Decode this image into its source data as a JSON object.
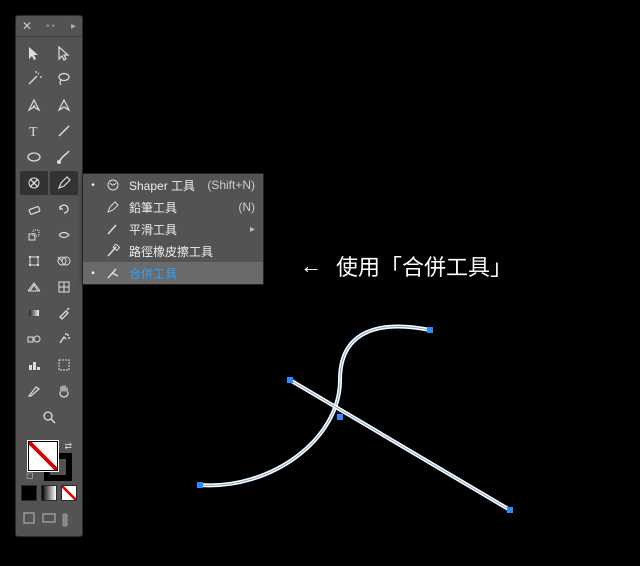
{
  "tools": [
    {
      "name": "selection-tool",
      "svg": "sel"
    },
    {
      "name": "direct-selection-tool",
      "svg": "dsel"
    },
    {
      "name": "magic-wand-tool",
      "svg": "wand"
    },
    {
      "name": "lasso-tool",
      "svg": "lasso"
    },
    {
      "name": "pen-tool",
      "svg": "pen"
    },
    {
      "name": "curvature-tool",
      "svg": "curv"
    },
    {
      "name": "type-tool",
      "svg": "type"
    },
    {
      "name": "line-segment-tool",
      "svg": "line"
    },
    {
      "name": "ellipse-tool",
      "svg": "ellipse"
    },
    {
      "name": "paintbrush-tool",
      "svg": "brush"
    },
    {
      "name": "shaper-tool",
      "svg": "shaper",
      "selected": true
    },
    {
      "name": "pencil-tool",
      "svg": "pencil",
      "open": true
    },
    {
      "name": "eraser-tool",
      "svg": "eraser"
    },
    {
      "name": "rotate-tool",
      "svg": "rotate"
    },
    {
      "name": "scale-tool",
      "svg": "scale"
    },
    {
      "name": "width-tool",
      "svg": "width"
    },
    {
      "name": "free-transform-tool",
      "svg": "freetr"
    },
    {
      "name": "shape-builder-tool",
      "svg": "shapeb"
    },
    {
      "name": "perspective-grid-tool",
      "svg": "persp"
    },
    {
      "name": "mesh-tool",
      "svg": "mesh"
    },
    {
      "name": "gradient-tool",
      "svg": "grad"
    },
    {
      "name": "eyedropper-tool",
      "svg": "eye"
    },
    {
      "name": "blend-tool",
      "svg": "blend"
    },
    {
      "name": "symbol-sprayer-tool",
      "svg": "spray"
    },
    {
      "name": "column-graph-tool",
      "svg": "graph"
    },
    {
      "name": "artboard-tool",
      "svg": "artb"
    },
    {
      "name": "slice-tool",
      "svg": "slice"
    },
    {
      "name": "hand-tool",
      "svg": "hand"
    },
    {
      "name": "zoom-tool",
      "svg": "zoom"
    }
  ],
  "flyout": {
    "items": [
      {
        "checked": true,
        "label": "Shaper 工具",
        "shortcut": "(Shift+N)",
        "icon": "shaper"
      },
      {
        "label": "鉛筆工具",
        "shortcut": "(N)",
        "icon": "pencil"
      },
      {
        "label": "平滑工具",
        "icon": "smooth",
        "arrow": true
      },
      {
        "label": "路徑橡皮擦工具",
        "icon": "patheraser"
      },
      {
        "label": "合併工具",
        "icon": "join",
        "hover": true
      }
    ]
  },
  "annotation": {
    "arrow": "←",
    "text": "使用「合併工具」"
  },
  "footer": {
    "screen": "screen-mode-icon",
    "draw": "draw-mode-icon"
  }
}
